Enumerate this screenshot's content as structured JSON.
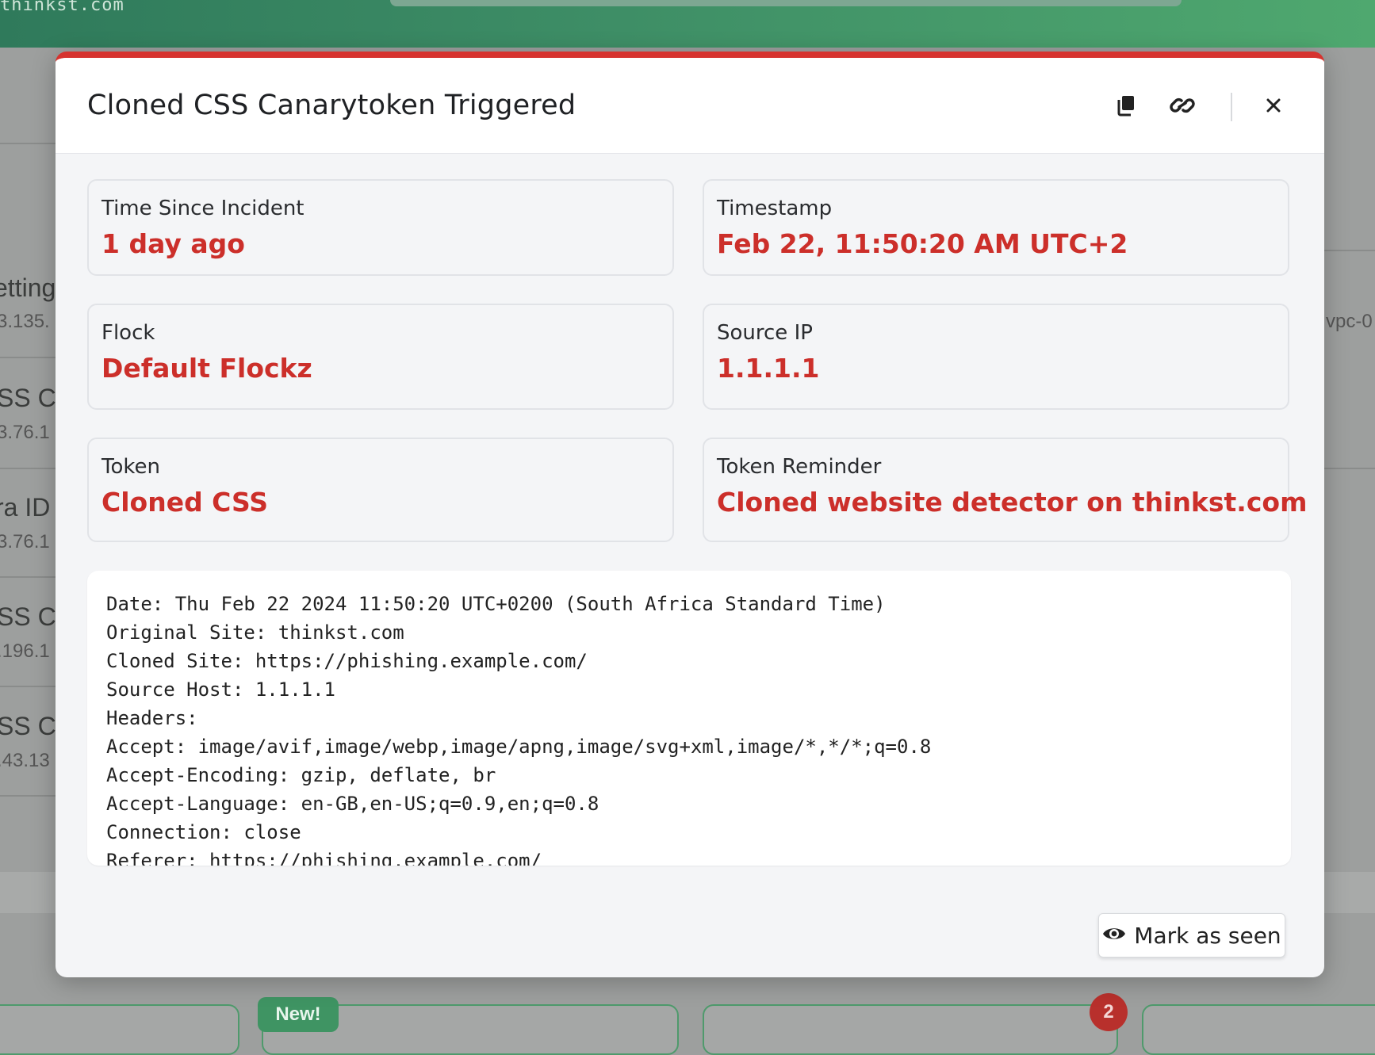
{
  "background": {
    "domain": "thinkst.com",
    "rows": [
      {
        "title": "etting",
        "sub": "3.135."
      },
      {
        "title": "SS Ca",
        "sub": "3.76.1"
      },
      {
        "title": "ra ID",
        "sub": "3.76.1"
      },
      {
        "title": "SS Ca",
        "sub": ".196.1"
      },
      {
        "title": "SS Ca",
        "sub": ".43.13"
      }
    ],
    "right_text": "vpc-0",
    "new_badge": "New!",
    "count_badge": "2"
  },
  "modal": {
    "title": "Cloned CSS Canarytoken Triggered",
    "accent_color": "#d6332f",
    "header_icons": [
      "copy-icon",
      "link-icon",
      "close-icon"
    ],
    "fields": {
      "time_since": {
        "label": "Time Since Incident",
        "value": "1 day ago"
      },
      "timestamp": {
        "label": "Timestamp",
        "value": "Feb 22, 11:50:20 AM UTC+2"
      },
      "flock": {
        "label": "Flock",
        "value": "Default Flockz"
      },
      "source_ip": {
        "label": "Source IP",
        "value": "1.1.1.1"
      },
      "token": {
        "label": "Token",
        "value": "Cloned CSS"
      },
      "token_reminder": {
        "label": "Token Reminder",
        "value": "Cloned website detector on thinkst.com"
      }
    },
    "log_lines": [
      "Date: Thu Feb 22 2024 11:50:20 UTC+0200 (South Africa Standard Time)",
      "Original Site: thinkst.com",
      "Cloned Site: https://phishing.example.com/",
      "Source Host: 1.1.1.1",
      "Headers:",
      "Accept: image/avif,image/webp,image/apng,image/svg+xml,image/*,*/*;q=0.8",
      "Accept-Encoding: gzip, deflate, br",
      "Accept-Language: en-GB,en-US;q=0.9,en;q=0.8",
      "Connection: close",
      "Referer: https://phishing.example.com/"
    ],
    "mark_seen_label": "Mark as seen"
  }
}
